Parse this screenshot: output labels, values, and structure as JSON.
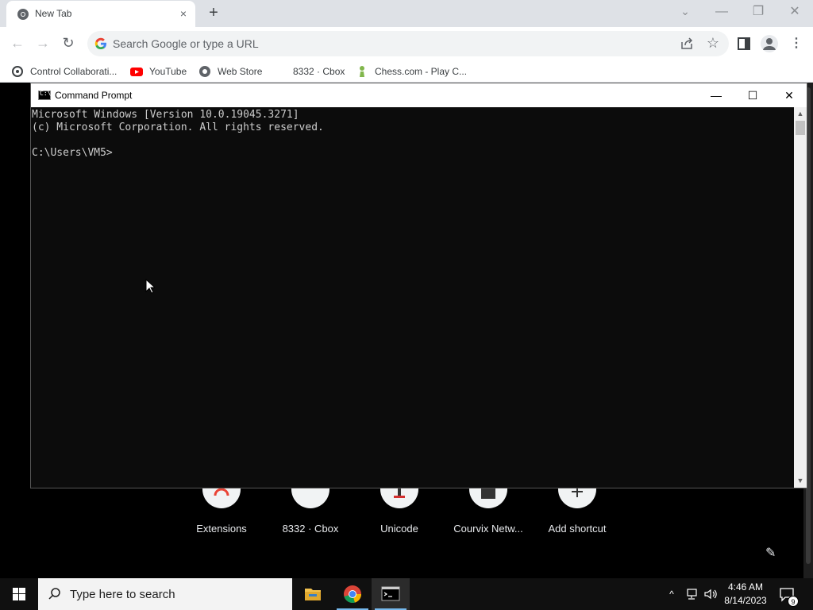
{
  "browser": {
    "tab": {
      "title": "New Tab",
      "favicon": "chrome-icon",
      "close": "×"
    },
    "new_tab": "+",
    "window_controls": {
      "tab_search": "⌄",
      "minimize": "—",
      "maximize": "❐",
      "close": "✕"
    },
    "toolbar": {
      "back": "←",
      "forward": "→",
      "reload": "↻",
      "omnibox_placeholder": "Search Google or type a URL",
      "star": "☆",
      "menu": "⋮"
    },
    "bookmarks": [
      {
        "label": "Control Collaborati...",
        "icon": "control-icon"
      },
      {
        "label": "YouTube",
        "icon": "youtube-icon"
      },
      {
        "label": "Web Store",
        "icon": "webstore-icon"
      },
      {
        "label": "8332 · Cbox",
        "icon": "blank-icon"
      },
      {
        "label": "Chess.com - Play C...",
        "icon": "chess-icon"
      }
    ],
    "shortcuts": [
      {
        "label": "Extensions"
      },
      {
        "label": "8332 · Cbox"
      },
      {
        "label": "Unicode"
      },
      {
        "label": "Courvix Netw..."
      },
      {
        "label": "Add shortcut"
      }
    ],
    "customize_icon": "✎"
  },
  "cmd": {
    "title": "Command Prompt",
    "icon_text": "C:\\",
    "controls": {
      "minimize": "—",
      "maximize": "☐",
      "close": "✕"
    },
    "lines": [
      "Microsoft Windows [Version 10.0.19045.3271]",
      "(c) Microsoft Corporation. All rights reserved.",
      "",
      "C:\\Users\\VM5>"
    ],
    "scroll_up": "▲",
    "scroll_down": "▼"
  },
  "taskbar": {
    "search_placeholder": "Type here to search",
    "tray_chevron": "^",
    "time": "4:46 AM",
    "date": "8/14/2023",
    "notification_count": "9"
  },
  "colors": {
    "tabbar": "#dee1e6",
    "console_bg": "#0c0c0c",
    "console_text": "#cccccc",
    "taskbar": "#101010",
    "accent": "#76b9ed"
  }
}
